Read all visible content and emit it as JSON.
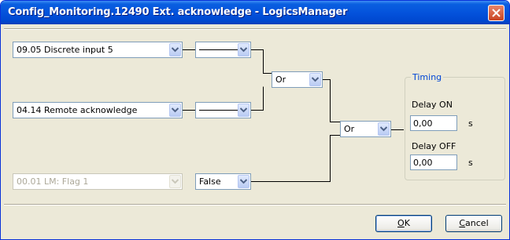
{
  "window": {
    "title": "Config_Monitoring.12490 Ext. acknowledge - LogicsManager",
    "close_icon": "close-x-icon"
  },
  "inputs": [
    {
      "variable": "09.05 Discrete input 5",
      "sign": "———",
      "enabled": true
    },
    {
      "variable": "04.14 Remote acknowledge",
      "sign": "———",
      "enabled": true
    },
    {
      "variable": "00.01 LM: Flag 1",
      "sign": "False",
      "enabled": false
    }
  ],
  "operators": [
    {
      "value": "Or"
    },
    {
      "value": "Or"
    }
  ],
  "timing": {
    "title": "Timing",
    "delay_on_label": "Delay ON",
    "delay_on_value": "0,00",
    "delay_on_unit": "s",
    "delay_off_label": "Delay OFF",
    "delay_off_value": "0,00",
    "delay_off_unit": "s"
  },
  "buttons": {
    "ok": {
      "accel": "O",
      "rest": "K"
    },
    "cancel": {
      "accel": "C",
      "rest": "ancel"
    }
  },
  "colors": {
    "titlebar": "#0453dc",
    "face": "#ece9d8",
    "group_title": "#0046d5"
  }
}
